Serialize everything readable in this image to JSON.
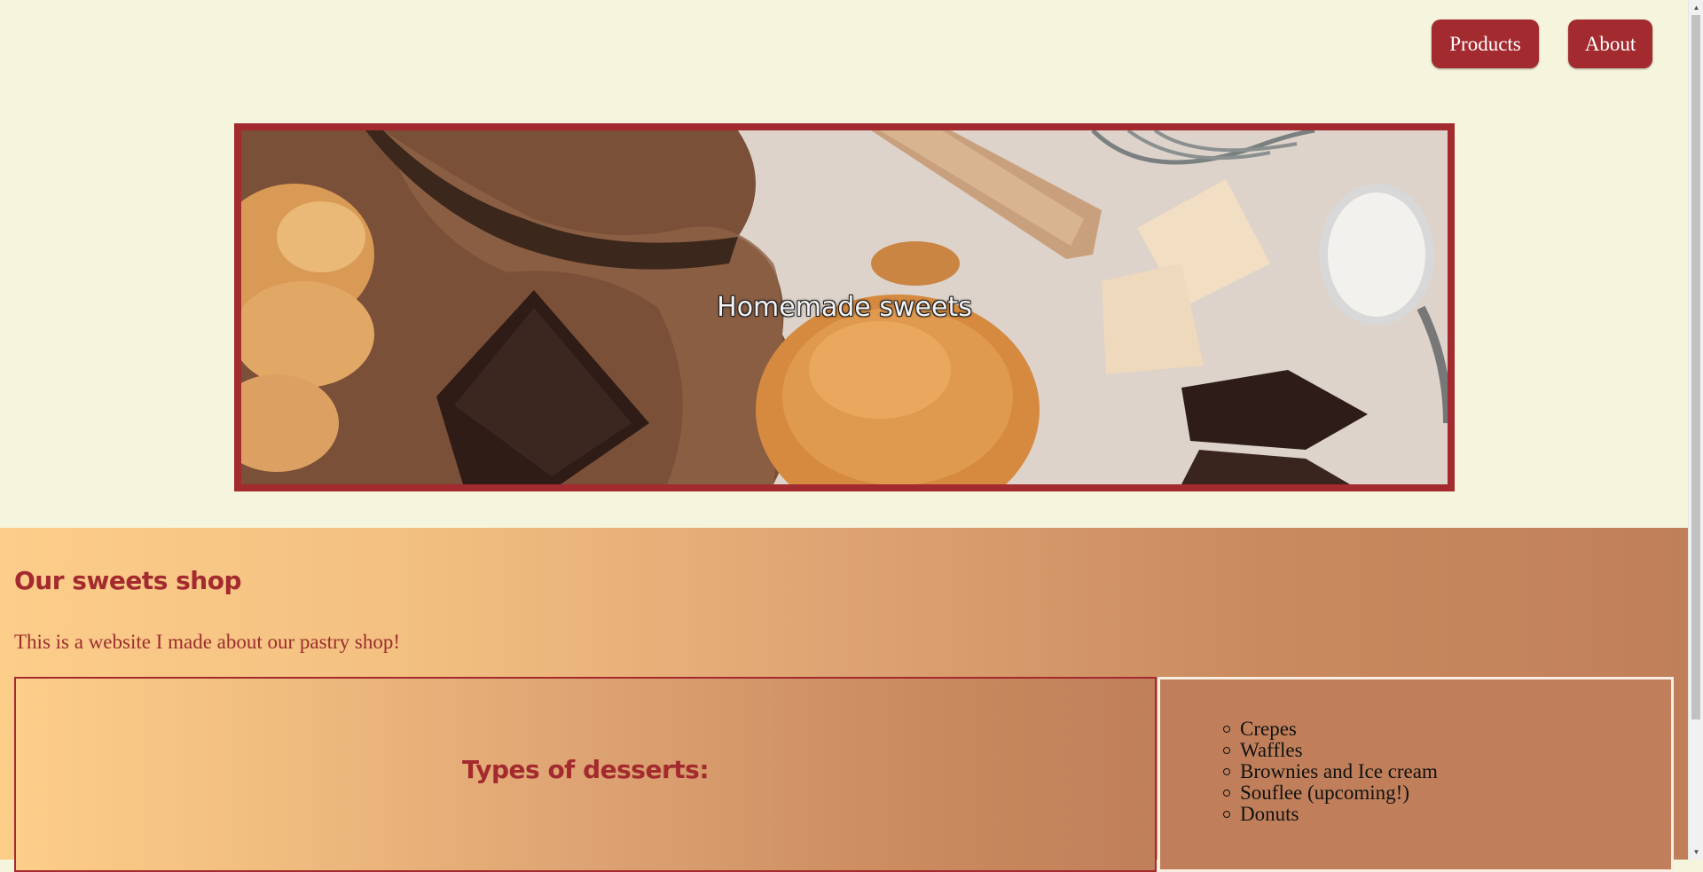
{
  "nav": {
    "products_label": "Products",
    "about_label": "About"
  },
  "hero": {
    "caption": "Homemade sweets"
  },
  "main": {
    "title": "Our sweets shop",
    "intro": "This is a website I made about our pastry shop!",
    "types_title": "Types of desserts:",
    "desserts": [
      "Crepes",
      "Waffles",
      "Brownies and Ice cream",
      "Souflee (upcoming!)",
      "Donuts"
    ]
  },
  "colors": {
    "accent": "#a32a2e",
    "page_bg": "#f5f4dc",
    "section_gradient_start": "#fdcd8a",
    "section_gradient_end": "#c07f5a"
  }
}
